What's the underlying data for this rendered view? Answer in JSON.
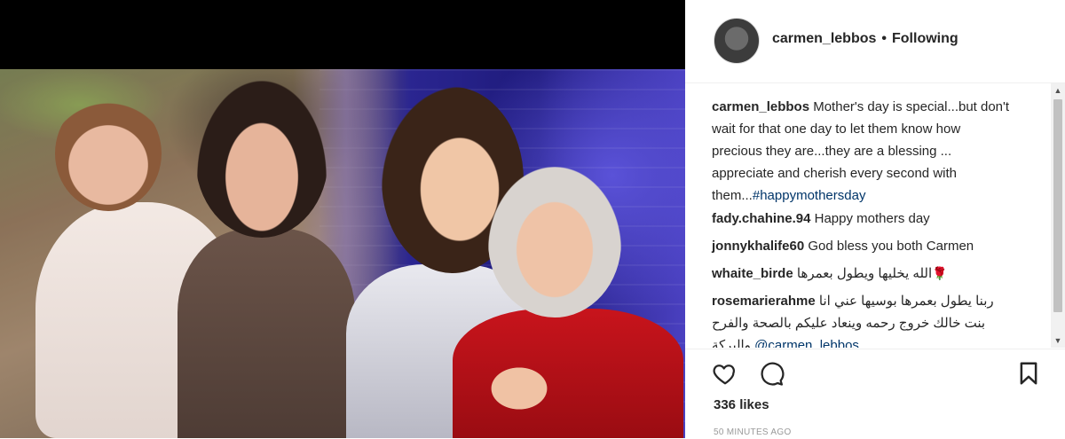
{
  "post": {
    "username": "carmen_lebbos",
    "follow_status": "Following",
    "separator": "•"
  },
  "caption": {
    "username": "carmen_lebbos",
    "text": "Mother's day is special...but don't wait for that one day to let them know how precious they are...they are a blessing ... appreciate and cherish every second with them...",
    "hashtag": "#happymothersday"
  },
  "comments": [
    {
      "username": "fady.chahine.94",
      "text": "Happy mothers day"
    },
    {
      "username": "jonnykhalife60",
      "text": "God bless you both Carmen"
    },
    {
      "username": "whaite_birde",
      "text": "الله يخليها ويطول بعمرها",
      "emoji": "🌹"
    },
    {
      "username": "rosemarierahme",
      "text": "ربنا يطول بعمرها بوسيها عني انا بنت خالك خروج رحمه وينعاد عليكم بالصحة والفرح والبركة",
      "mention": "@carmen_lebbos"
    }
  ],
  "icons": {
    "like": "heart-icon",
    "comment": "comment-bubble-icon",
    "save": "bookmark-icon",
    "scroll_up": "scroll-up-arrow",
    "scroll_down": "scroll-down-arrow"
  },
  "likes": "336 likes",
  "timestamp": "50 MINUTES AGO",
  "colors": {
    "text": "#262626",
    "link": "#003569",
    "muted": "#999999",
    "border": "#efefef"
  }
}
